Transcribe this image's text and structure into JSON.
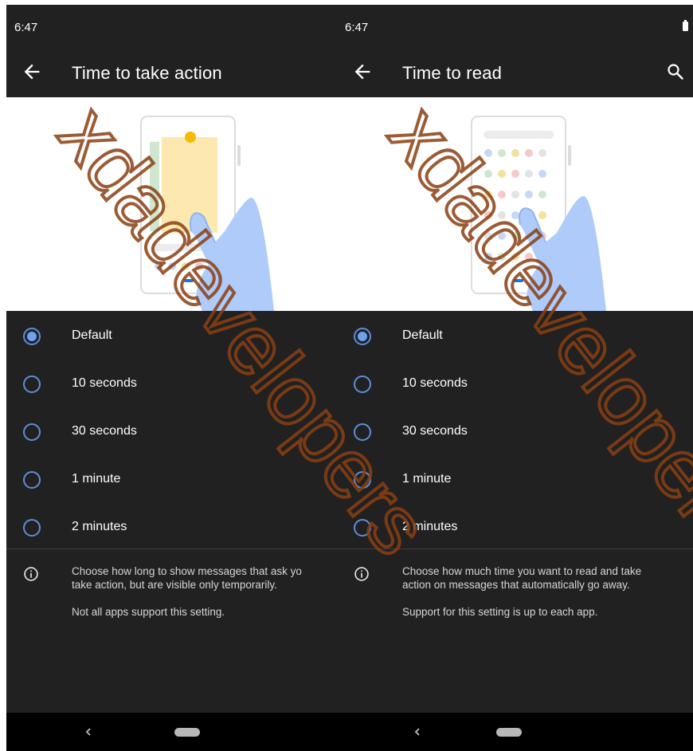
{
  "screens": [
    {
      "status_time": "6:47",
      "title": "Time to take action",
      "options": [
        {
          "label": "Default",
          "checked": true
        },
        {
          "label": "10 seconds",
          "checked": false
        },
        {
          "label": "30 seconds",
          "checked": false
        },
        {
          "label": "1 minute",
          "checked": false
        },
        {
          "label": "2 minutes",
          "checked": false
        }
      ],
      "info_line_1": "Choose how long to show messages that ask yo",
      "info_line_2": "take action, but are visible only temporarily.",
      "info_note": "Not all apps support this setting."
    },
    {
      "status_time": "6:47",
      "title": "Time to read",
      "options": [
        {
          "label": "Default",
          "checked": true
        },
        {
          "label": "10 seconds",
          "checked": false
        },
        {
          "label": "30 seconds",
          "checked": false
        },
        {
          "label": "1 minute",
          "checked": false
        },
        {
          "label": "2 minutes",
          "checked": false
        }
      ],
      "info_line_1": "Choose how much time you want to read and take",
      "info_line_2": "action on messages that automatically go away.",
      "info_note": "Support for this setting is up to each app."
    }
  ],
  "watermark_text": "xdadevelopers",
  "colors": {
    "background": "#212121",
    "accent": "#6fa0f0",
    "watermark": "#8a3f12"
  },
  "icons": {
    "back": "arrow-back-icon",
    "search": "search-icon",
    "info": "info-icon",
    "battery": "battery-icon",
    "nav_back": "chevron-left-icon"
  }
}
